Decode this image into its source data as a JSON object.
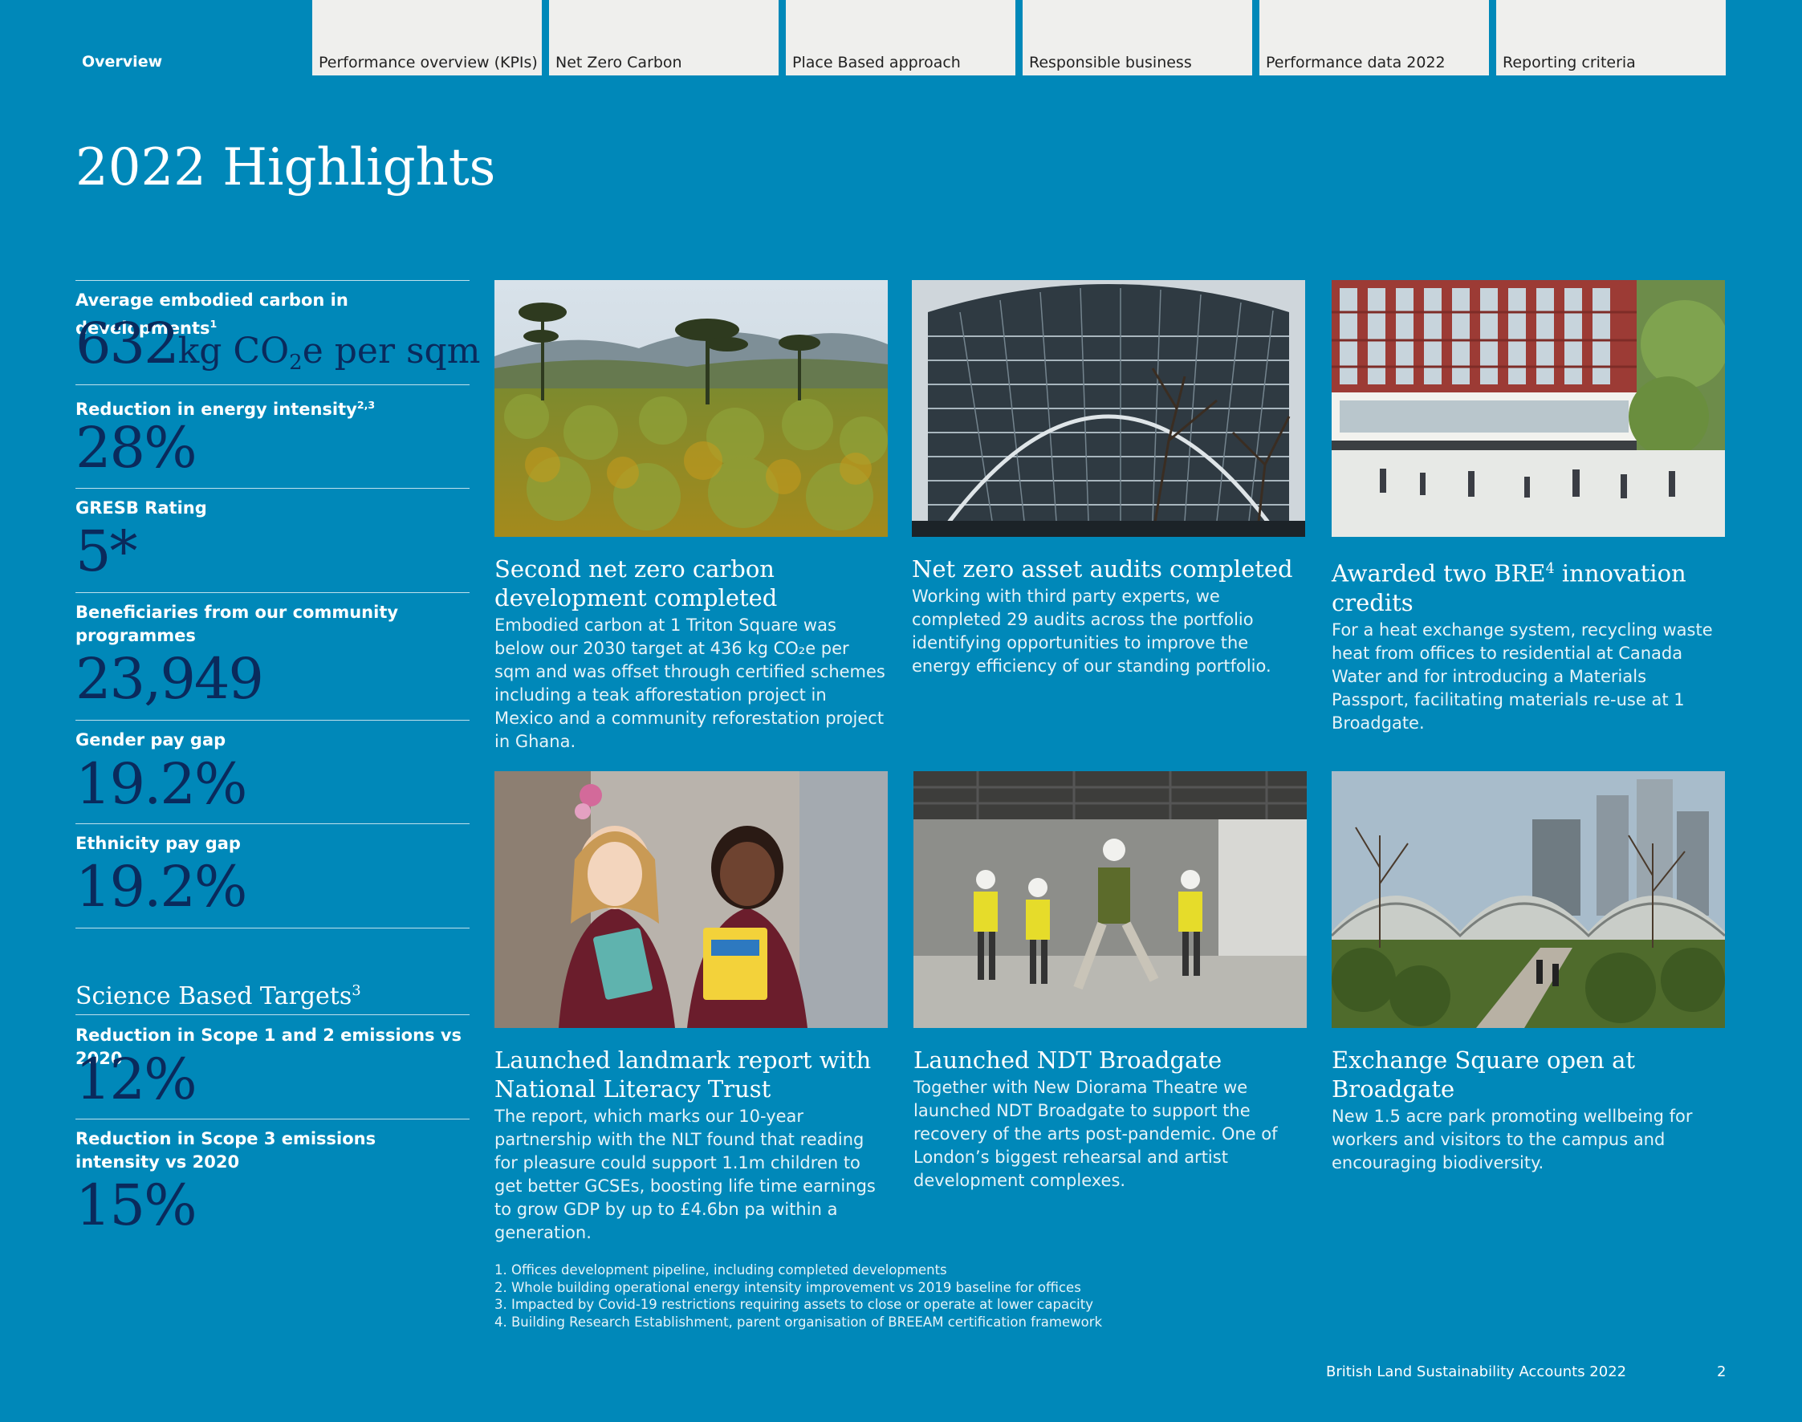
{
  "nav": {
    "overview": "Overview",
    "tabs": [
      "Performance overview (KPIs)",
      "Net Zero Carbon",
      "Place Based approach",
      "Responsible business",
      "Performance data 2022",
      "Reporting criteria"
    ]
  },
  "title": "2022 Highlights",
  "kpis": [
    {
      "label": "Average embodied carbon in developments",
      "sup": "1",
      "value": "632",
      "unit_a": "kg CO",
      "unit_sub": "2",
      "unit_b": "e per sqm"
    },
    {
      "label": "Reduction in energy intensity",
      "sup": "2,3",
      "value": "28%"
    },
    {
      "label": "GRESB Rating",
      "value": "5*"
    },
    {
      "label": "Beneficiaries from our community programmes",
      "value": "23,949"
    },
    {
      "label": "Gender pay gap",
      "value": "19.2%"
    },
    {
      "label": "Ethnicity pay gap",
      "value": "19.2%"
    }
  ],
  "sbt": {
    "heading": "Science Based Targets",
    "sup": "3",
    "items": [
      {
        "label": "Reduction in Scope 1 and 2 emissions vs 2020",
        "value": "12%"
      },
      {
        "label": "Reduction in Scope 3 emissions intensity vs 2020",
        "value": "15%"
      }
    ]
  },
  "cards": [
    {
      "title": "Second net zero carbon development completed",
      "text": "Embodied carbon at 1 Triton Square was below our 2030 target at 436 kg CO₂e per sqm and was offset through certified schemes including a teak afforestation project in Mexico and a community reforestation project in Ghana."
    },
    {
      "title": "Net zero asset audits completed",
      "text": "Working with third party experts, we completed 29 audits across the portfolio identifying opportunities to improve the energy efficiency of our standing portfolio."
    },
    {
      "title_a": "Awarded two BRE",
      "title_sup": "4",
      "title_b": " innovation credits",
      "text": "For a heat exchange system, recycling waste heat from offices to residential at Canada Water and for introducing a Materials Passport, facilitating materials re-use at 1 Broadgate."
    },
    {
      "title": "Launched landmark report with National Literacy Trust",
      "text": "The report, which marks our 10-year partnership with the NLT found that reading for pleasure could support 1.1m children to get better GCSEs, boosting life time earnings to grow GDP by up to £4.6bn pa within a generation."
    },
    {
      "title": "Launched NDT Broadgate",
      "text": "Together with New Diorama Theatre we launched NDT Broadgate to support the recovery of the arts post-pandemic. One of London’s biggest rehearsal and artist development complexes."
    },
    {
      "title": "Exchange Square open at Broadgate",
      "text": "New 1.5 acre park promoting wellbeing for workers and visitors to the campus and encouraging biodiversity."
    }
  ],
  "footnotes": [
    "1.  Offices development pipeline, including completed developments",
    "2.  Whole building operational energy intensity improvement vs 2019 baseline for offices",
    "3.  Impacted by Covid-19 restrictions requiring assets to close or operate at lower capacity",
    "4.  Building Research Establishment, parent organisation of BREEAM certification framework"
  ],
  "footer": {
    "text": "British Land Sustainability Accounts 2022",
    "page": "2"
  }
}
